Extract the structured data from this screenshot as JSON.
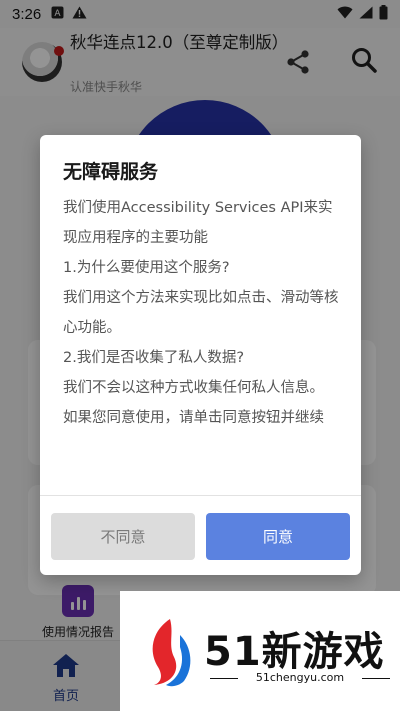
{
  "status_bar": {
    "time": "3:26",
    "left_icons": [
      "a-icon",
      "warning-icon"
    ],
    "right_icons": [
      "wifi-icon",
      "signal-icon",
      "battery-icon"
    ]
  },
  "app_bar": {
    "title": "秋华连点12.0（至尊定制版）",
    "subtitle": "认准快手秋华",
    "actions": [
      "share-icon",
      "search-icon"
    ]
  },
  "background_feature": {
    "label": "使用情况报告",
    "icon": "bar-chart-icon",
    "icon_color": "#6a2fb3"
  },
  "bottom_nav": {
    "items": [
      {
        "label": "首页",
        "icon": "home-icon"
      }
    ],
    "active_color": "#1e3a8a"
  },
  "dialog": {
    "title": "无障碍服务",
    "paragraphs": [
      "我们使用Accessibility Services API来实现应用程序的主要功能",
      "1.为什么要使用这个服务?",
      "我们用这个方法来实现比如点击、滑动等核心功能。",
      "2.我们是否收集了私人数据?",
      "我们不会以这种方式收集任何私人信息。",
      "如果您同意使用，请单击同意按钮并继续"
    ],
    "disagree_label": "不同意",
    "agree_label": "同意",
    "agree_color": "#5b82e0"
  },
  "watermark": {
    "brand": "51新游戏",
    "domain": "51chengyu.com"
  }
}
